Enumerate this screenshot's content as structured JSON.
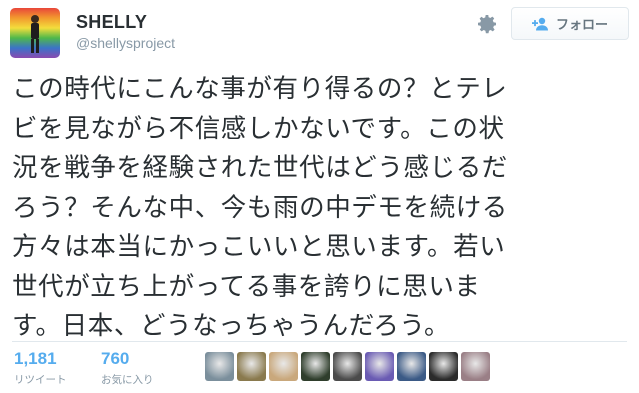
{
  "profile": {
    "name": "SHELLY",
    "handle": "@shellysproject"
  },
  "actions": {
    "settings_icon": "gear-icon",
    "follow_icon": "add-user-icon",
    "follow_label": "フォロー"
  },
  "tweet": {
    "text": "この時代にこんな事が有り得るの？とテレ\nビを見ながら不信感しかないです。この状\n況を戦争を経験された世代はどう感じるだ\nろう？そんな中、今も雨の中デモを続ける\n方々は本当にかっこいいと思います。若い\n世代が立ち上がってる事を誇りに思いま\nす。日本、どうなっちゃうんだろう。"
  },
  "stats": {
    "retweets": {
      "count": "1,181",
      "label": "リツイート"
    },
    "favorites": {
      "count": "760",
      "label": "お気に入り"
    }
  },
  "favoriters": {
    "colors": [
      "#7b8f9c",
      "#8a7a4e",
      "#c9a87c",
      "#2f3e2c",
      "#4b4b4b",
      "#6a5bb3",
      "#3b5a86",
      "#2b2b2b",
      "#9a7f86"
    ]
  },
  "colors": {
    "link_blue": "#55acee",
    "muted": "#8899a6",
    "text": "#292f33"
  }
}
